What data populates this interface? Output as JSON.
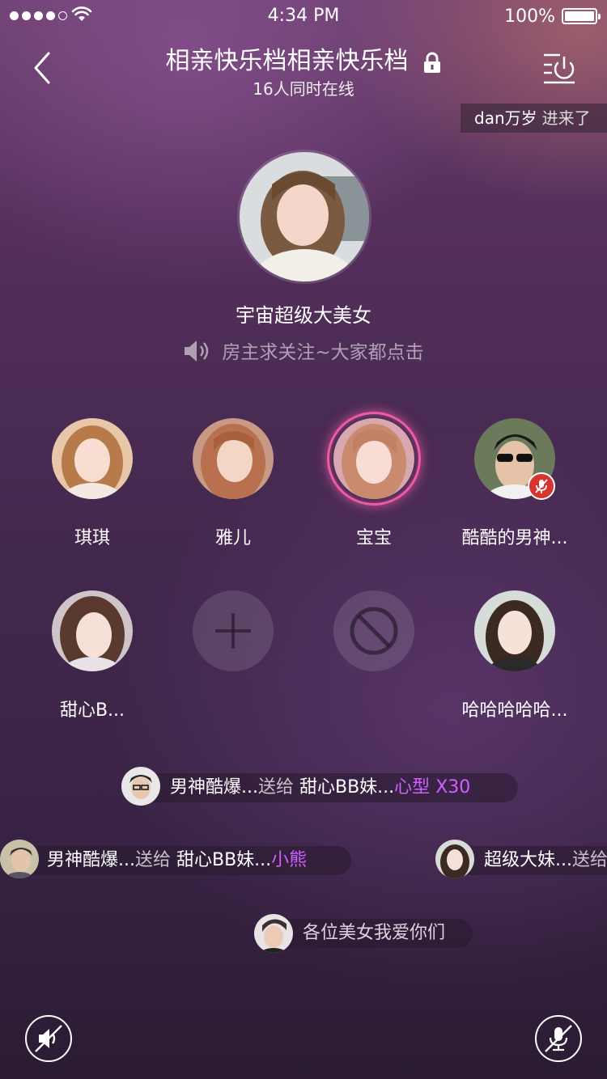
{
  "status_bar": {
    "time": "4:34 PM",
    "battery": "100%"
  },
  "header": {
    "title": "相亲快乐档相亲快乐档",
    "subtitle": "16人同时在线"
  },
  "toast": {
    "user": "dan万岁",
    "action": "进来了"
  },
  "host": {
    "name": "宇宙超级大美女",
    "notice": "房主求关注~大家都点击"
  },
  "seats": [
    {
      "name": "琪琪"
    },
    {
      "name": "雅儿"
    },
    {
      "name": "宝宝"
    },
    {
      "name": "酷酷的男神..."
    },
    {
      "name": "甜心B..."
    },
    {
      "name": ""
    },
    {
      "name": ""
    },
    {
      "name": "哈哈哈哈哈..."
    }
  ],
  "gifts": [
    {
      "sender": "男神酷爆...",
      "verb": "送给",
      "receiver": "甜心BB妹...",
      "gift": "心型",
      "count": "X30"
    },
    {
      "sender": "男神酷爆...",
      "verb": "送给",
      "receiver": "甜心BB妹...",
      "gift": "小熊",
      "count": ""
    },
    {
      "sender": "超级大妹...",
      "verb": "送给",
      "receiver": "",
      "gift": "",
      "count": ""
    }
  ],
  "chat": {
    "message": "各位美女我爱你们"
  },
  "colors": {
    "accent": "#d060ff",
    "speaking": "#ee5aa4",
    "mic_off": "#d9332f"
  }
}
